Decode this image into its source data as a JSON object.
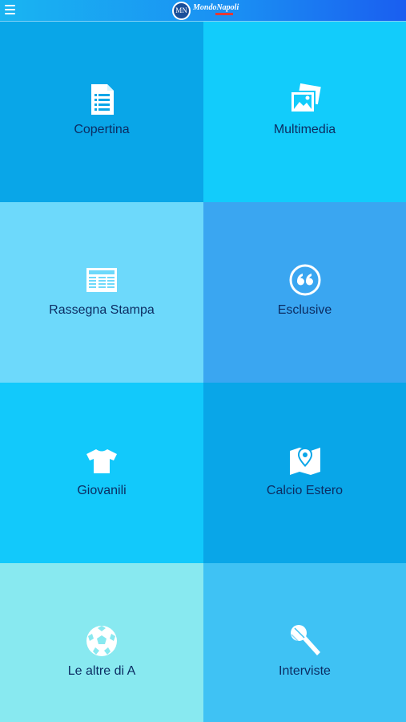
{
  "header": {
    "logo_badge": "MN",
    "logo_name": "MondoNapoli",
    "menu_icon": "hamburger-icon",
    "colors": {
      "start": "#19b5f2",
      "end": "#1a5ef0"
    }
  },
  "tiles": [
    {
      "label": "Copertina",
      "icon": "document-icon",
      "color": "#09a6e8"
    },
    {
      "label": "Multimedia",
      "icon": "photos-icon",
      "color": "#12ccfb"
    },
    {
      "label": "Rassegna Stampa",
      "icon": "newspaper-icon",
      "color": "#6dd9fb"
    },
    {
      "label": "Esclusive",
      "icon": "quote-icon",
      "color": "#3aa6f1"
    },
    {
      "label": "Giovanili",
      "icon": "tshirt-icon",
      "color": "#12c9fb"
    },
    {
      "label": "Calcio Estero",
      "icon": "map-pin-icon",
      "color": "#09a6e8"
    },
    {
      "label": "Le altre di A",
      "icon": "soccer-ball-icon",
      "color": "#88e9f0"
    },
    {
      "label": "Interviste",
      "icon": "microphone-icon",
      "color": "#3fc2f4"
    }
  ]
}
